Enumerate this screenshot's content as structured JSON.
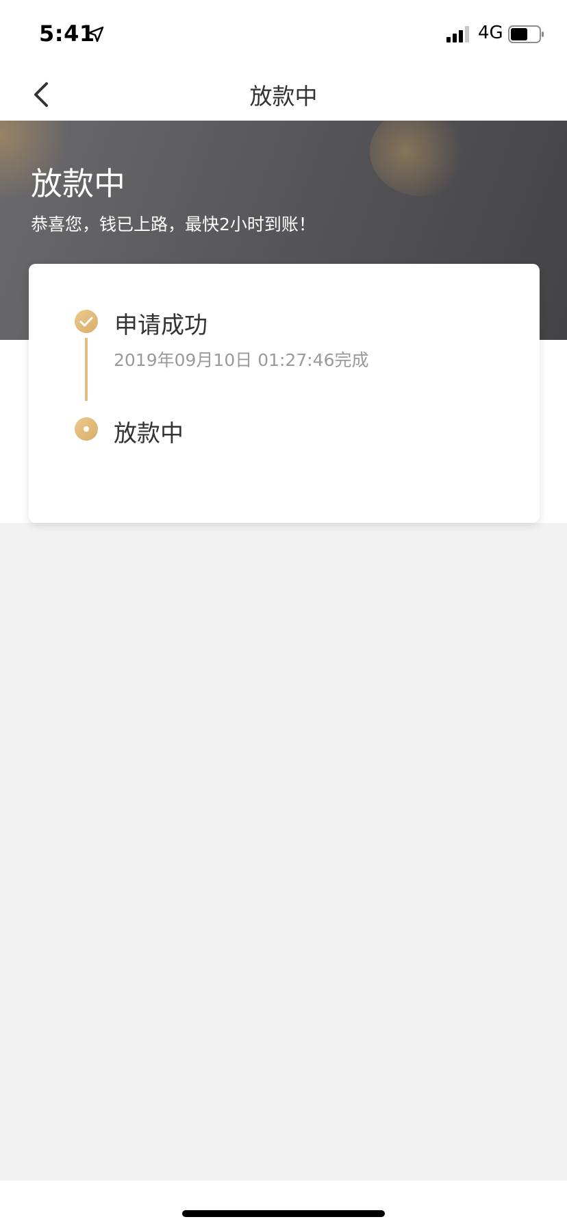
{
  "status_bar": {
    "time": "5:41",
    "network": "4G",
    "icons": [
      "location-arrow-icon",
      "signal-icon",
      "battery-icon"
    ]
  },
  "nav": {
    "title": "放款中",
    "back_icon": "chevron-left-icon"
  },
  "banner": {
    "title": "放款中",
    "subtitle": "恭喜您，钱已上路，最快2小时到账！"
  },
  "steps": [
    {
      "title": "申请成功",
      "time": "2019年09月10日 01:27:46完成",
      "icon": "check-circle-icon",
      "status": "completed"
    },
    {
      "title": "放款中",
      "icon": "current-dot-icon",
      "status": "in-progress"
    }
  ],
  "colors": {
    "accent_gold": "#e2bd7e",
    "banner_dark": "#434245",
    "banner_light": "#6b6a6d",
    "page_grey": "#f2f2f2",
    "muted_text": "#9a9a9a"
  }
}
